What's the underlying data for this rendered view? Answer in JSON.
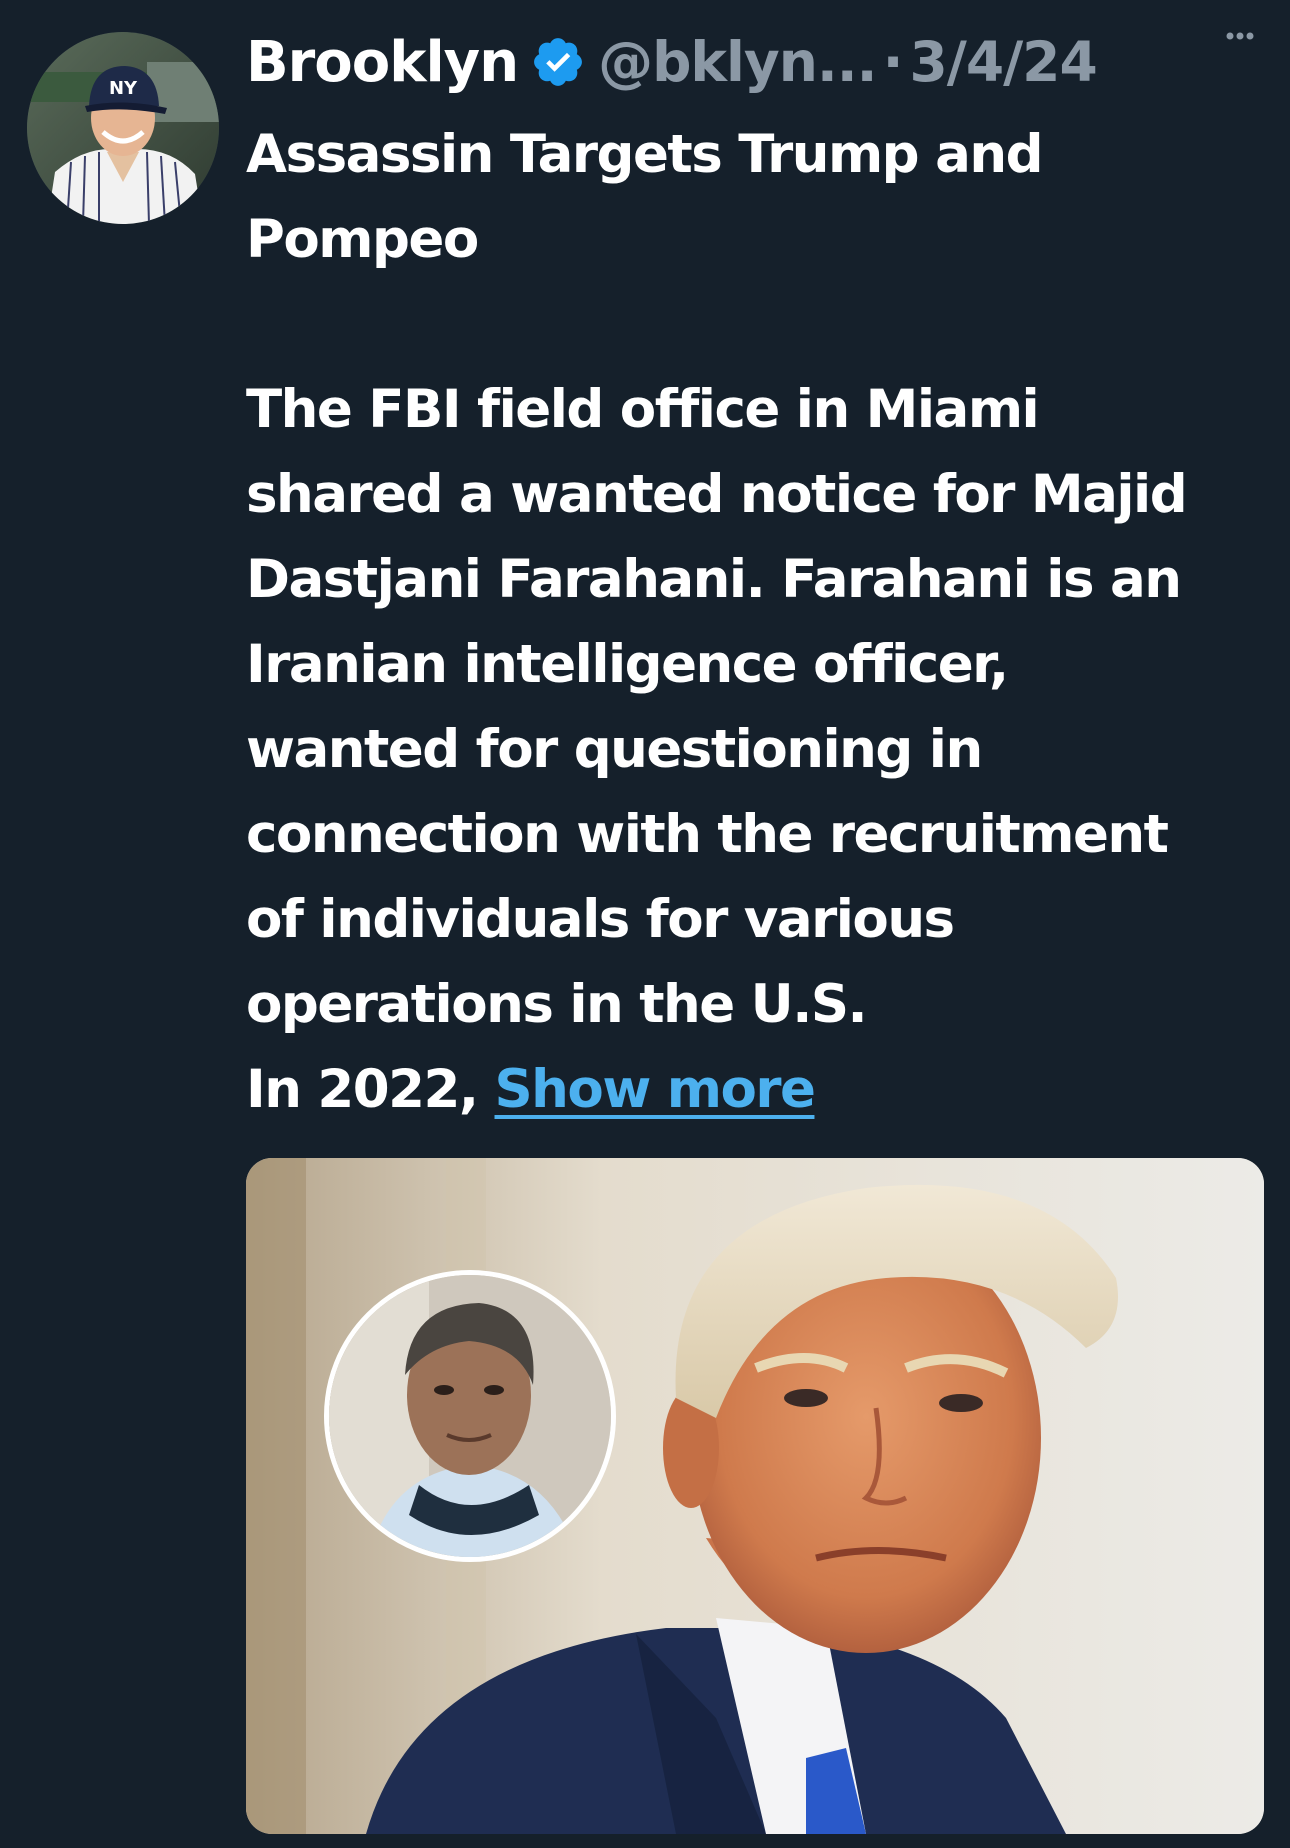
{
  "tweet": {
    "display_name": "Brooklyn",
    "handle": "@bklyn...",
    "separator": "·",
    "date": "3/4/24",
    "lines": [
      "Assassin Targets Trump and",
      "Pompeo",
      "",
      "The FBI field office in Miami",
      "shared a wanted notice for Majid",
      "Dastjani Farahani. Farahani is an",
      "Iranian intelligence officer,",
      "wanted for questioning in",
      "connection with the recruitment",
      "of individuals for various",
      "operations in the U.S."
    ],
    "last_line_prefix": "In 2022, ",
    "show_more": "Show more"
  },
  "icons": {
    "verified": "verified-badge-icon",
    "more": "more-horizontal-icon"
  },
  "colors": {
    "background": "#15202b",
    "text": "#ffffff",
    "secondary": "#8b98a5",
    "link": "#4cb0ee",
    "verified": "#1d9bf0"
  }
}
